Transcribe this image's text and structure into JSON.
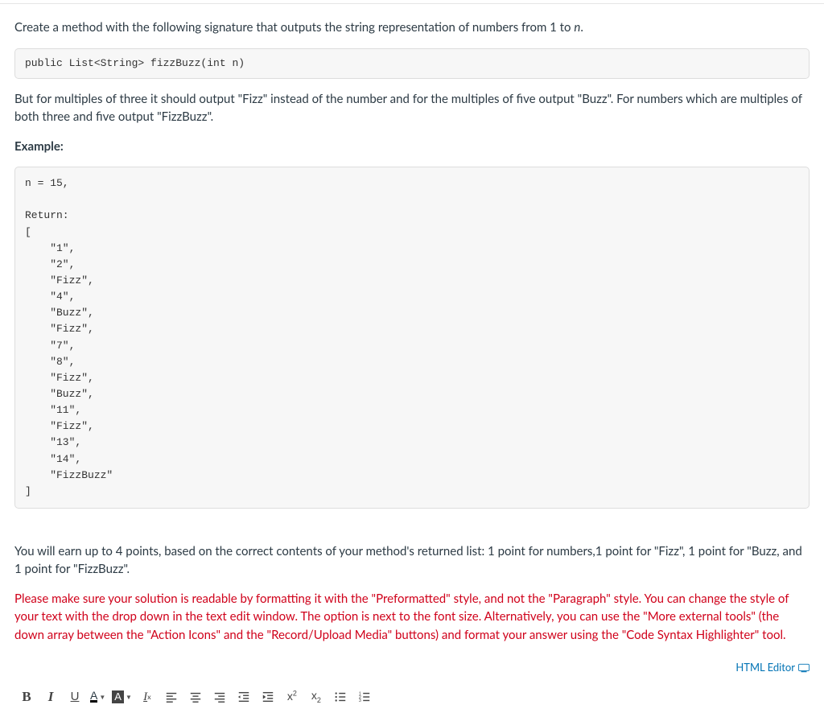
{
  "intro": {
    "line1_a": "Create a method with the following signature that outputs the string representation of numbers from 1 to ",
    "line1_var": "n",
    "line1_b": "."
  },
  "signature": "public List<String> fizzBuzz(int n)",
  "rules": "But for multiples of three it should output \"Fizz\" instead of the number and for the multiples of five output \"Buzz\". For numbers which are multiples of both three and five output \"FizzBuzz\".",
  "example_label": "Example:",
  "example_code": "n = 15,\n\nReturn:\n[\n    \"1\",\n    \"2\",\n    \"Fizz\",\n    \"4\",\n    \"Buzz\",\n    \"Fizz\",\n    \"7\",\n    \"8\",\n    \"Fizz\",\n    \"Buzz\",\n    \"11\",\n    \"Fizz\",\n    \"13\",\n    \"14\",\n    \"FizzBuzz\"\n]",
  "grading": "You will earn up to 4 points, based on the correct contents of your method's returned list: 1 point for numbers,1 point for \"Fizz\", 1 point for \"Buzz, and 1 point for \"FizzBuzz\".",
  "red_note": "Please make sure your solution is readable by formatting it with the \"Preformatted\" style, and not the \"Paragraph\" style. You can change the style of your text with the drop down in the text edit window. The option is next to the font size.  Alternatively, you can use the \"More external tools\" (the down array between the \"Action Icons\" and the \"Record/Upload Media\" buttons) and format your answer using the \"Code Syntax Highlighter\" tool.",
  "editor_link": "HTML Editor",
  "toolbar": {
    "bold": "B",
    "italic": "I",
    "underline": "U",
    "textcolor": "A",
    "bgcolor": "A",
    "sup": "x",
    "sup2": "2",
    "sub": "x",
    "sub2": "2"
  }
}
